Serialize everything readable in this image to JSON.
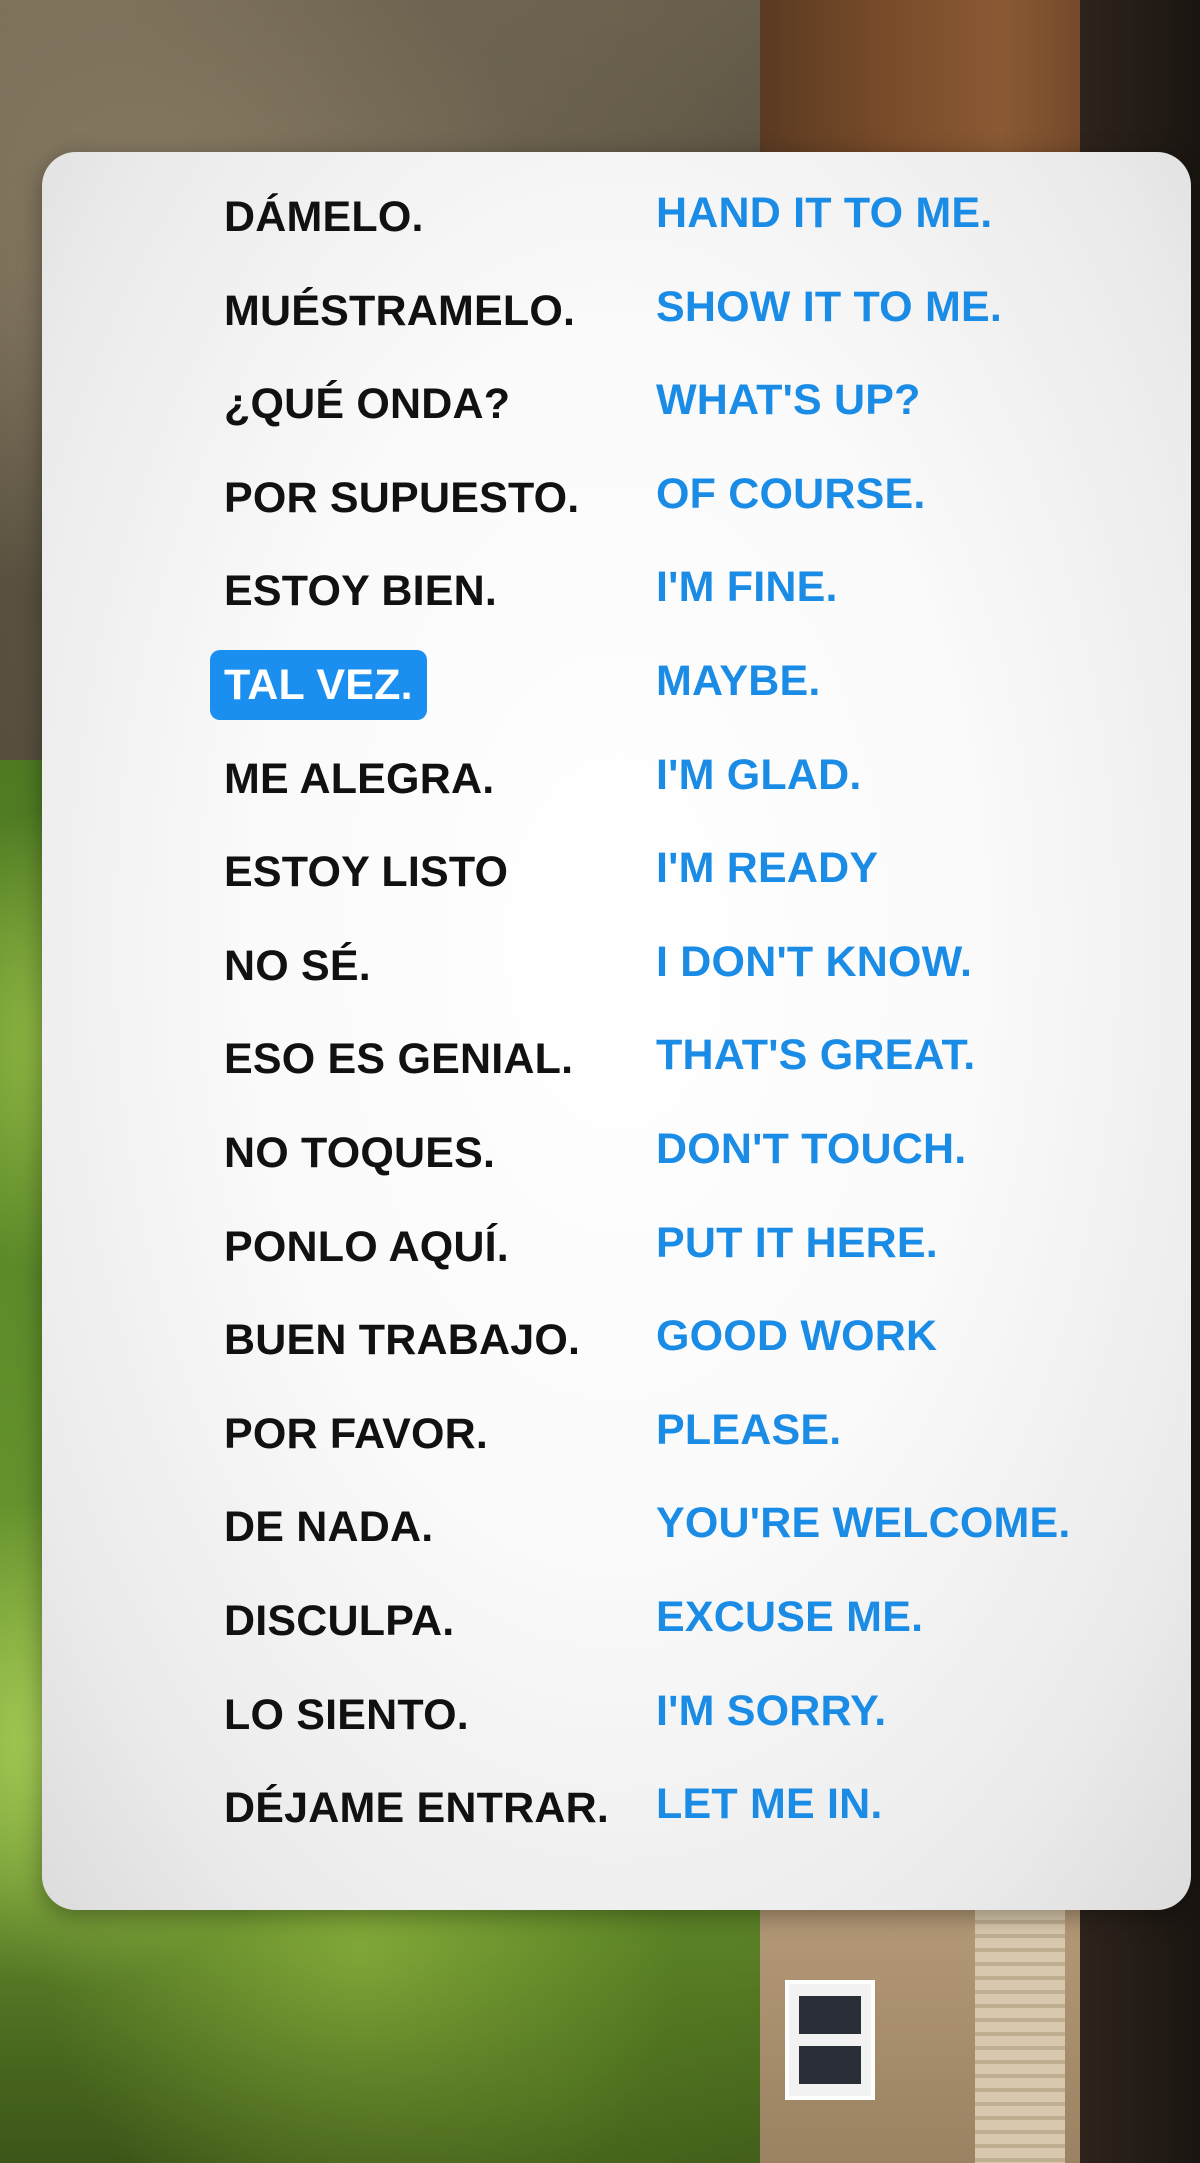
{
  "colors": {
    "spanish_text": "#111111",
    "english_text": "#1b8ce6",
    "highlight_bg": "#1a8ff0",
    "highlight_text": "#ffffff",
    "card_bg": "#ffffff"
  },
  "phrases": [
    {
      "es": "DÁMELO.",
      "en": "HAND IT TO ME.",
      "highlighted": false
    },
    {
      "es": "MUÉSTRAMELO.",
      "en": "SHOW IT TO ME.",
      "highlighted": false
    },
    {
      "es": "¿QUÉ ONDA?",
      "en": "WHAT'S UP?",
      "highlighted": false
    },
    {
      "es": "POR SUPUESTO.",
      "en": "OF COURSE.",
      "highlighted": false
    },
    {
      "es": "ESTOY BIEN.",
      "en": "I'M FINE.",
      "highlighted": false
    },
    {
      "es": "TAL VEZ.",
      "en": "MAYBE.",
      "highlighted": true
    },
    {
      "es": "ME ALEGRA.",
      "en": "I'M GLAD.",
      "highlighted": false
    },
    {
      "es": "ESTOY LISTO",
      "en": "I'M READY",
      "highlighted": false
    },
    {
      "es": "NO SÉ.",
      "en": "I DON'T KNOW.",
      "highlighted": false
    },
    {
      "es": "ESO ES GENIAL.",
      "en": "THAT'S GREAT.",
      "highlighted": false
    },
    {
      "es": "NO TOQUES.",
      "en": "DON'T TOUCH.",
      "highlighted": false
    },
    {
      "es": "PONLO AQUÍ.",
      "en": "PUT IT HERE.",
      "highlighted": false
    },
    {
      "es": "BUEN TRABAJO.",
      "en": "GOOD WORK",
      "highlighted": false
    },
    {
      "es": "POR FAVOR.",
      "en": "PLEASE.",
      "highlighted": false
    },
    {
      "es": "DE NADA.",
      "en": "YOU'RE WELCOME.",
      "highlighted": false
    },
    {
      "es": "DISCULPA.",
      "en": "EXCUSE ME.",
      "highlighted": false
    },
    {
      "es": "LO SIENTO.",
      "en": "I'M SORRY.",
      "highlighted": false
    },
    {
      "es": "DÉJAME ENTRAR.",
      "en": "LET ME IN.",
      "highlighted": false
    }
  ]
}
